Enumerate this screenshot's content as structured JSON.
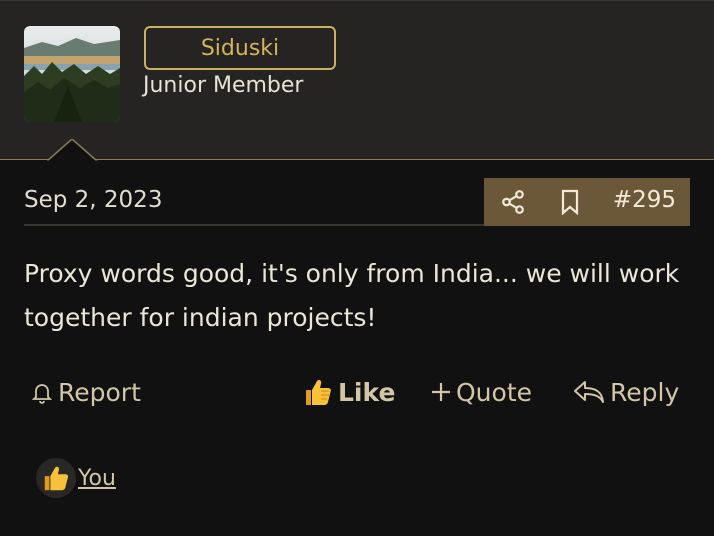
{
  "author": {
    "username": "Siduski",
    "title": "Junior Member",
    "avatar_icon": "landscape-avatar"
  },
  "post": {
    "date": "Sep 2, 2023",
    "number": "#295",
    "message": "Proxy words good, it's only from India... we will work together for indian projects!"
  },
  "actions": {
    "report": "Report",
    "like": "Like",
    "quote": "Quote",
    "reply": "Reply"
  },
  "reactions": {
    "icon": "thumbs-up-emoji",
    "user": "You"
  },
  "colors": {
    "accent": "#cbb063",
    "action_box": "#6a5838",
    "header_bg": "#262422",
    "page_bg": "#111111"
  }
}
